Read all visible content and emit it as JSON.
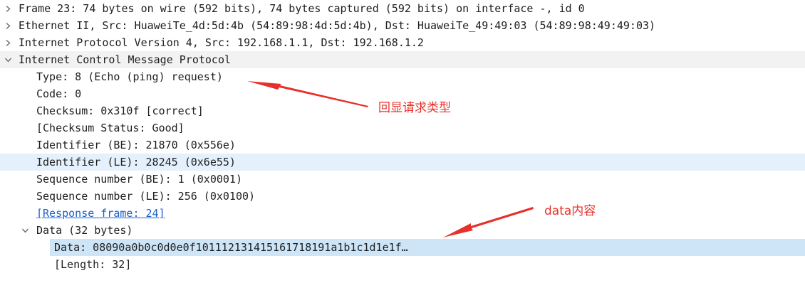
{
  "packet_tree": {
    "rows": [
      {
        "text": "Frame 23: 74 bytes on wire (592 bits), 74 bytes captured (592 bits) on interface -, id 0",
        "expanded": false
      },
      {
        "text": "Ethernet II, Src: HuaweiTe_4d:5d:4b (54:89:98:4d:5d:4b), Dst: HuaweiTe_49:49:03 (54:89:98:49:49:03)",
        "expanded": false
      },
      {
        "text": "Internet Protocol Version 4, Src: 192.168.1.1, Dst: 192.168.1.2",
        "expanded": false
      },
      {
        "text": "Internet Control Message Protocol",
        "expanded": true
      },
      {
        "text": "Type: 8 (Echo (ping) request)"
      },
      {
        "text": "Code: 0"
      },
      {
        "text": "Checksum: 0x310f [correct]"
      },
      {
        "text": "[Checksum Status: Good]"
      },
      {
        "text": "Identifier (BE): 21870 (0x556e)"
      },
      {
        "text": "Identifier (LE): 28245 (0x6e55)"
      },
      {
        "text": "Sequence number (BE): 1 (0x0001)"
      },
      {
        "text": "Sequence number (LE): 256 (0x0100)"
      },
      {
        "text": "[Response frame: 24]"
      },
      {
        "text": "Data (32 bytes)",
        "expanded": true
      },
      {
        "text": "Data: 08090a0b0c0d0e0f101112131415161718191a1b1c1d1e1f…"
      },
      {
        "text": "[Length: 32]"
      }
    ]
  },
  "annotations": {
    "echo_request_label": "回显请求类型",
    "data_label": "data内容",
    "color": "#e8302a"
  },
  "colors": {
    "selected_row": "#cde5f7",
    "hover_row": "#e4f0fb",
    "link": "#1a5fc8",
    "expanded_header": "#f2f2f2"
  }
}
